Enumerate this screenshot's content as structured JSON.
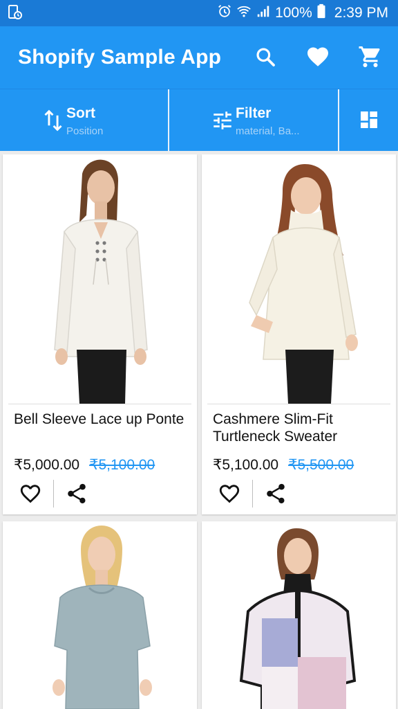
{
  "status_bar": {
    "battery": "100%",
    "time": "2:39 PM",
    "icons": [
      "notification-icon",
      "alarm-icon",
      "wifi-icon",
      "signal-icon",
      "battery-icon"
    ]
  },
  "app_bar": {
    "title": "Shopify Sample App",
    "icons": [
      "search-icon",
      "heart-icon",
      "cart-icon"
    ]
  },
  "toolbar": {
    "sort": {
      "label": "Sort",
      "value": "Position",
      "icon": "sort-icon"
    },
    "filter": {
      "label": "Filter",
      "value": "material, Ba...",
      "icon": "filter-icon"
    },
    "view_toggle_icon": "grid-layout-icon"
  },
  "products": [
    {
      "name": "Bell Sleeve Lace up Ponte",
      "price": "₹5,000.00",
      "old_price": "₹5,100.00"
    },
    {
      "name": "Cashmere Slim-Fit Turtleneck Sweater",
      "price": "₹5,100.00",
      "old_price": "₹5,500.00"
    },
    {
      "name": "",
      "price": "",
      "old_price": ""
    },
    {
      "name": "",
      "price": "",
      "old_price": ""
    }
  ],
  "colors": {
    "primary": "#2196f3",
    "status_bar": "#1a7ad6",
    "old_price": "#2196f3"
  }
}
